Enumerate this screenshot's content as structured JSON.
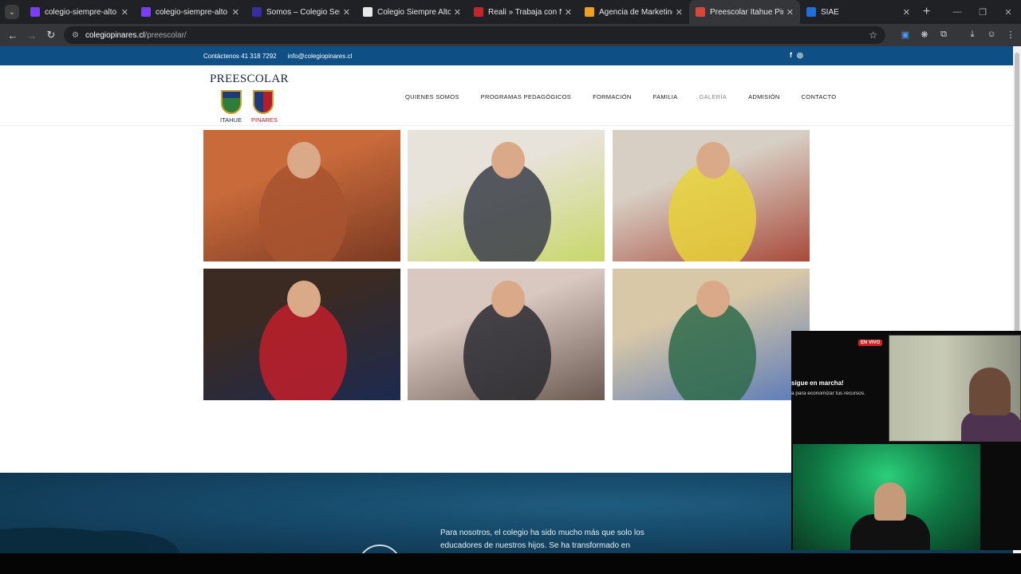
{
  "browser": {
    "tabs": [
      {
        "title": "colegio-siempre-alto",
        "fav_color": "#7b3ff2",
        "active": false
      },
      {
        "title": "colegio-siempre-alto",
        "fav_color": "#7b3ff2",
        "active": false
      },
      {
        "title": "Somos – Colegio Semper",
        "fav_color": "#3a2e9e",
        "active": false
      },
      {
        "title": "Colegio Siempre Alto — I",
        "fav_color": "#e8e8e8",
        "active": false
      },
      {
        "title": "Reali » Trabaja con Nosot",
        "fav_color": "#c0262d",
        "active": false
      },
      {
        "title": "Agencia de Marketing Dig",
        "fav_color": "#f0a020",
        "active": false
      },
      {
        "title": "Preescolar Itahue Pinares",
        "fav_color": "#d9463b",
        "active": true
      },
      {
        "title": "SIAE",
        "fav_color": "#1e6fd9",
        "active": false
      }
    ],
    "url_host": "colegiopinares.cl",
    "url_path": "/preescolar/"
  },
  "site": {
    "contact_phone": "Contáctenos 41 318 7292",
    "contact_email": "info@colegiopinares.cl",
    "social": [
      "f",
      "◎"
    ],
    "logo_title": "PREESCOLAR",
    "logo_left": "ITAHUE",
    "logo_right": "PINARES",
    "nav": [
      "QUIENES SOMOS",
      "PROGRAMAS PEDAGÓGICOS",
      "FORMACIÓN",
      "FAMILIA",
      "GALERÍA",
      "ADMISIÓN",
      "CONTACTO"
    ],
    "nav_active_index": 4,
    "quote": "Para nosotros, el colegio ha sido mucho más que solo los educadores de nuestros hijos. Se ha transformado en"
  },
  "gallery": [
    {
      "name": "child-at-painted-wall",
      "colors": [
        "#c86a3a",
        "#a8532f",
        "#7a3a22"
      ]
    },
    {
      "name": "teacher-with-children-drawing",
      "colors": [
        "#e8e3da",
        "#3b3e4a",
        "#c8d86a"
      ]
    },
    {
      "name": "girl-playing-with-clay",
      "colors": [
        "#d8cfc4",
        "#e8d23a",
        "#a84a3a"
      ]
    },
    {
      "name": "boys-making-peace-signs",
      "colors": [
        "#3a2a22",
        "#c21e2a",
        "#1c2a50"
      ]
    },
    {
      "name": "family-portrait",
      "colors": [
        "#d8c8c0",
        "#2a2a30",
        "#6a5a50"
      ]
    },
    {
      "name": "teacher-in-classroom",
      "colors": [
        "#d8c8a8",
        "#2e6a4a",
        "#5a7ab8"
      ]
    }
  ],
  "stream_overlay": {
    "live_badge": "EN VIVO",
    "text_line1": "sigue en marcha!",
    "text_line2": "a para economizar tus recursos."
  }
}
